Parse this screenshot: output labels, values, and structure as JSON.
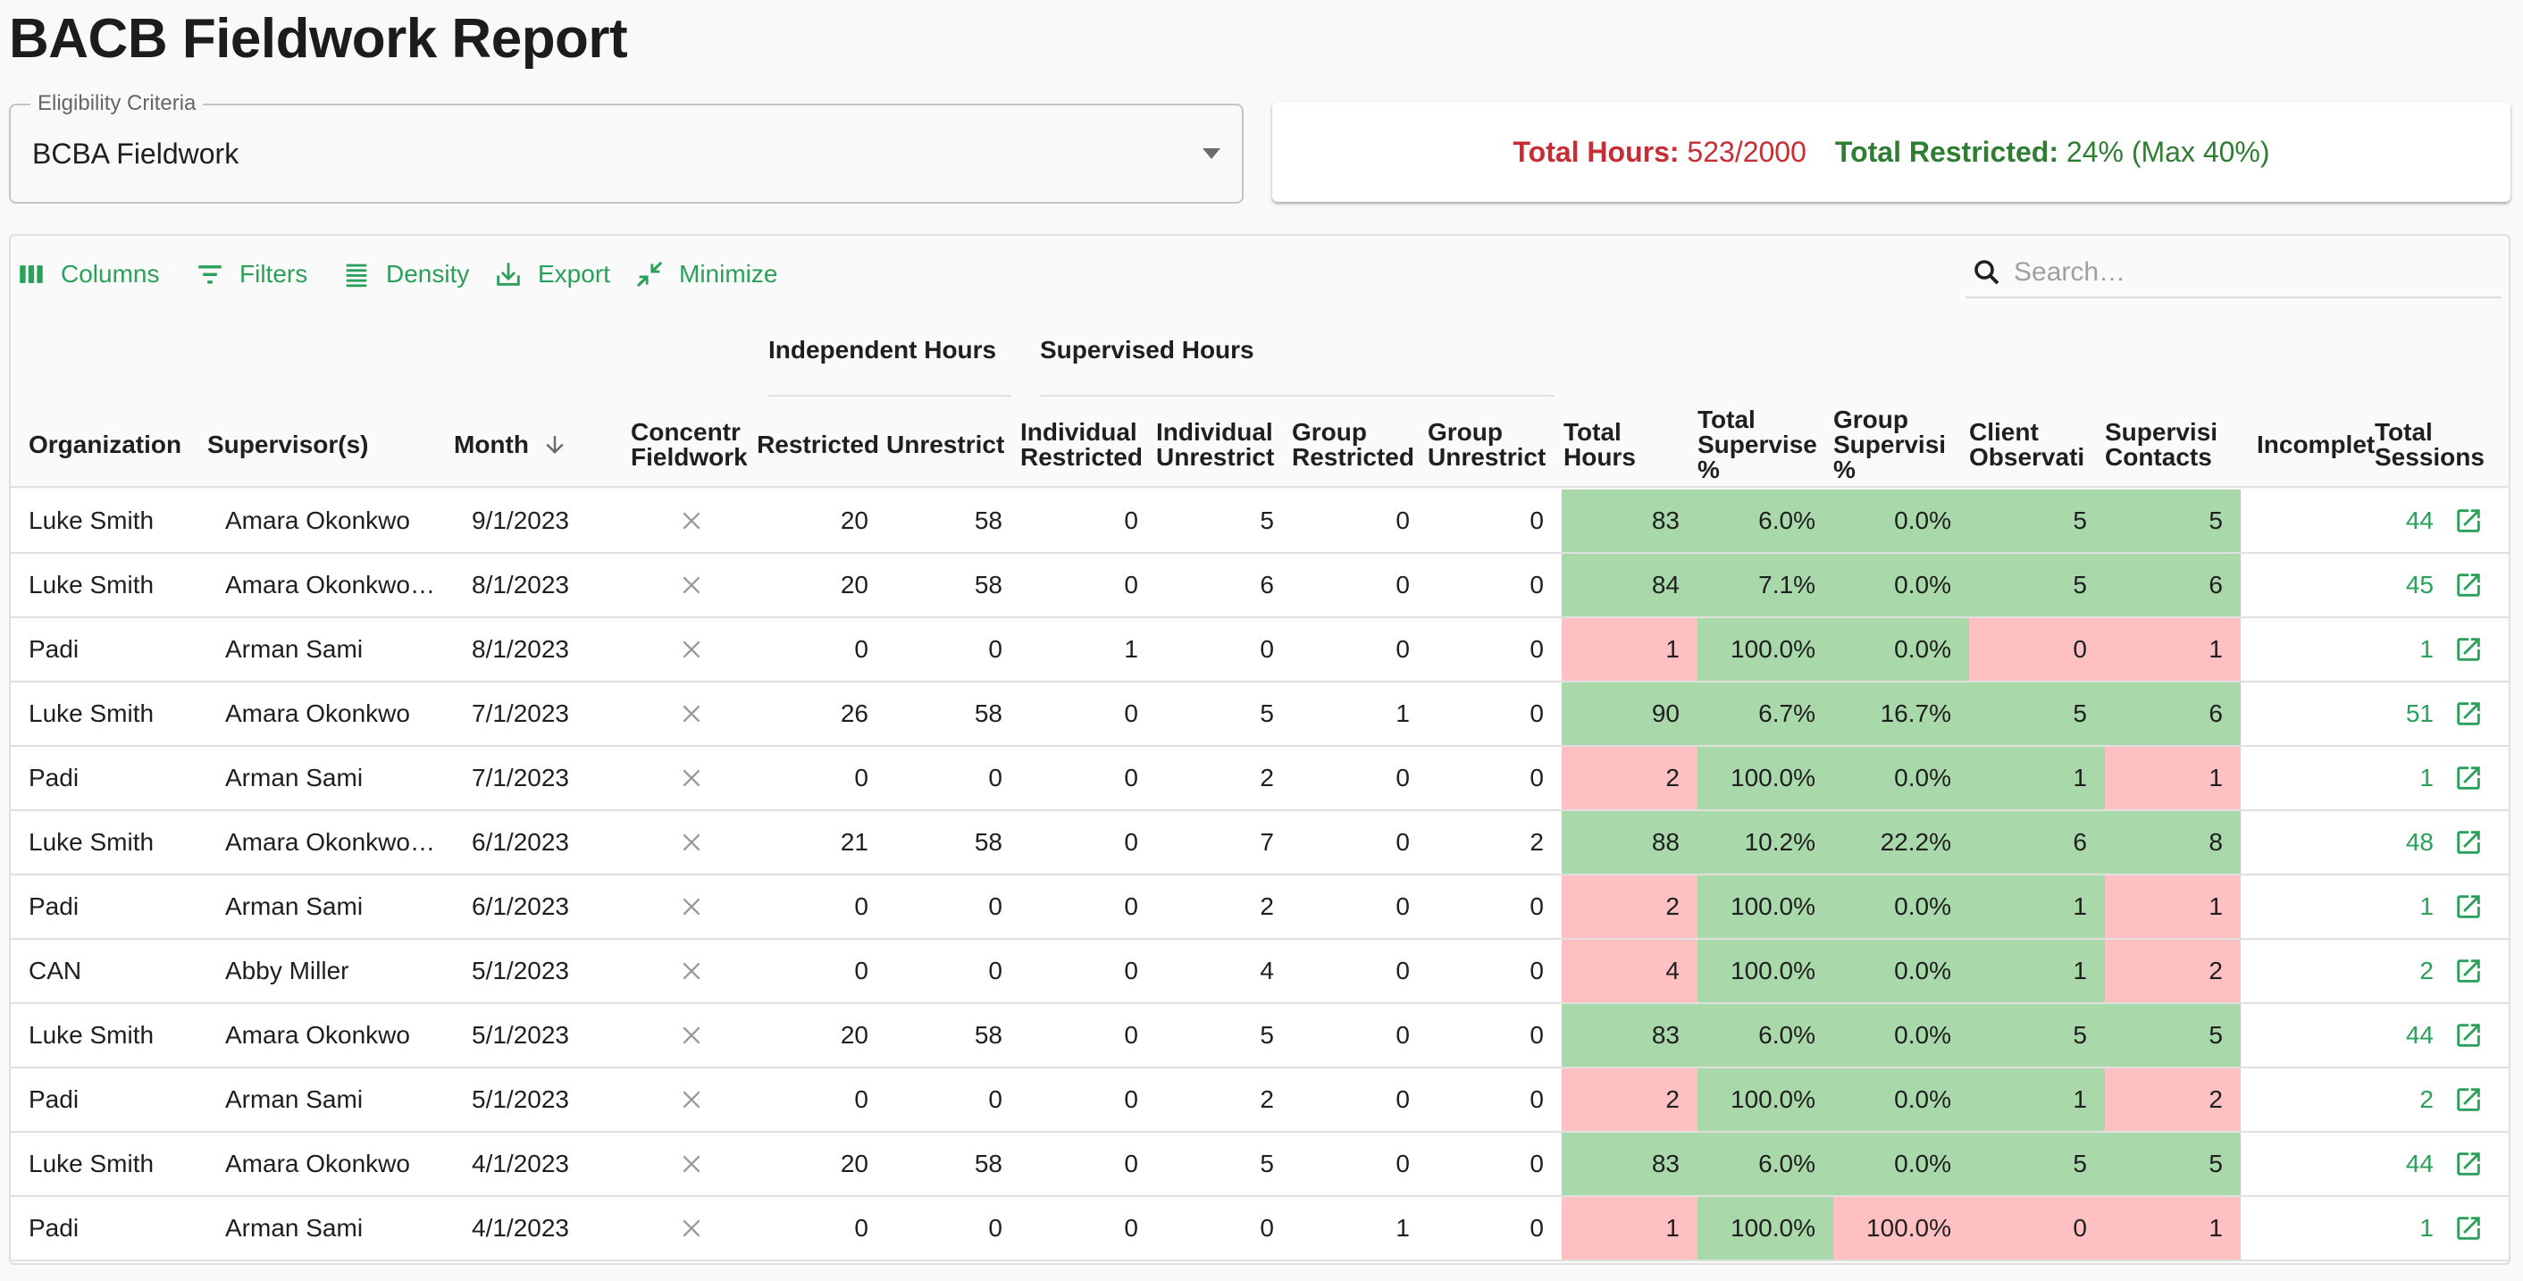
{
  "page": {
    "title": "BACB Fieldwork Report"
  },
  "eligibility": {
    "label": "Eligibility Criteria",
    "value": "BCBA Fieldwork",
    "icon": "arrow-drop-down-icon"
  },
  "summary": {
    "total_hours_label": "Total Hours:",
    "total_hours_value": "523/2000",
    "total_restricted_label": "Total Restricted:",
    "total_restricted_value": "24% (Max 40%)",
    "colors": {
      "hours": "#c62d34",
      "restricted": "#2e7d32"
    }
  },
  "toolbar": {
    "columns": {
      "label": "Columns",
      "icon": "view-column-icon"
    },
    "filters": {
      "label": "Filters",
      "icon": "filter-list-icon"
    },
    "density": {
      "label": "Density",
      "icon": "density-icon"
    },
    "export": {
      "label": "Export",
      "icon": "download-icon"
    },
    "minimize": {
      "label": "Minimize",
      "icon": "minimize-icon"
    },
    "search_placeholder": "Search…",
    "accent": "#2aa05a"
  },
  "table": {
    "group_headers": {
      "independent": "Independent Hours",
      "supervised": "Supervised Hours"
    },
    "columns": {
      "organization": "Organization",
      "supervisors": "Supervisor(s)",
      "month": "Month",
      "concentrated": "Concentr Fieldwork",
      "restricted": "Restricted",
      "unrestricted": "Unrestrict",
      "ind_restricted": "Individual Restricted",
      "ind_unrestricted": "Individual Unrestrict",
      "grp_restricted": "Group Restricted",
      "grp_unrestricted": "Group Unrestrict",
      "total_hours": "Total Hours",
      "total_supervised_pct": "Total Supervise %",
      "group_supervision_pct": "Group Supervisi %",
      "client_observations": "Client Observati",
      "supervision_contacts": "Supervisi Contacts",
      "incomplete": "Incomplet",
      "total_sessions": "Total Sessions"
    },
    "sort": {
      "column": "month",
      "direction": "descending"
    },
    "status_colors": {
      "ok": "#a9d9aa",
      "bad": "#ffc0c2"
    },
    "rows": [
      {
        "organization": "Luke Smith",
        "supervisors": "Amara Okonkwo",
        "month": "9/1/2023",
        "concentrated": false,
        "restricted": "20",
        "unrestricted": "58",
        "ind_restricted": "0",
        "ind_unrestricted": "5",
        "grp_restricted": "0",
        "grp_unrestricted": "0",
        "total_hours": "83",
        "total_supervised_pct": "6.0%",
        "group_supervision_pct": "0.0%",
        "client_observations": "5",
        "supervision_contacts": "5",
        "incomplete": "",
        "total_sessions": "44",
        "status": {
          "total_hours": "ok",
          "total_supervised_pct": "ok",
          "group_supervision_pct": "ok",
          "client_observations": "ok",
          "supervision_contacts": "ok"
        }
      },
      {
        "organization": "Luke Smith",
        "supervisors": "Amara Okonkwo…",
        "month": "8/1/2023",
        "concentrated": false,
        "restricted": "20",
        "unrestricted": "58",
        "ind_restricted": "0",
        "ind_unrestricted": "6",
        "grp_restricted": "0",
        "grp_unrestricted": "0",
        "total_hours": "84",
        "total_supervised_pct": "7.1%",
        "group_supervision_pct": "0.0%",
        "client_observations": "5",
        "supervision_contacts": "6",
        "incomplete": "",
        "total_sessions": "45",
        "status": {
          "total_hours": "ok",
          "total_supervised_pct": "ok",
          "group_supervision_pct": "ok",
          "client_observations": "ok",
          "supervision_contacts": "ok"
        }
      },
      {
        "organization": "Padi",
        "supervisors": "Arman Sami",
        "month": "8/1/2023",
        "concentrated": false,
        "restricted": "0",
        "unrestricted": "0",
        "ind_restricted": "1",
        "ind_unrestricted": "0",
        "grp_restricted": "0",
        "grp_unrestricted": "0",
        "total_hours": "1",
        "total_supervised_pct": "100.0%",
        "group_supervision_pct": "0.0%",
        "client_observations": "0",
        "supervision_contacts": "1",
        "incomplete": "",
        "total_sessions": "1",
        "status": {
          "total_hours": "bad",
          "total_supervised_pct": "ok",
          "group_supervision_pct": "ok",
          "client_observations": "bad",
          "supervision_contacts": "bad"
        }
      },
      {
        "organization": "Luke Smith",
        "supervisors": "Amara Okonkwo",
        "month": "7/1/2023",
        "concentrated": false,
        "restricted": "26",
        "unrestricted": "58",
        "ind_restricted": "0",
        "ind_unrestricted": "5",
        "grp_restricted": "1",
        "grp_unrestricted": "0",
        "total_hours": "90",
        "total_supervised_pct": "6.7%",
        "group_supervision_pct": "16.7%",
        "client_observations": "5",
        "supervision_contacts": "6",
        "incomplete": "",
        "total_sessions": "51",
        "status": {
          "total_hours": "ok",
          "total_supervised_pct": "ok",
          "group_supervision_pct": "ok",
          "client_observations": "ok",
          "supervision_contacts": "ok"
        }
      },
      {
        "organization": "Padi",
        "supervisors": "Arman Sami",
        "month": "7/1/2023",
        "concentrated": false,
        "restricted": "0",
        "unrestricted": "0",
        "ind_restricted": "0",
        "ind_unrestricted": "2",
        "grp_restricted": "0",
        "grp_unrestricted": "0",
        "total_hours": "2",
        "total_supervised_pct": "100.0%",
        "group_supervision_pct": "0.0%",
        "client_observations": "1",
        "supervision_contacts": "1",
        "incomplete": "",
        "total_sessions": "1",
        "status": {
          "total_hours": "bad",
          "total_supervised_pct": "ok",
          "group_supervision_pct": "ok",
          "client_observations": "ok",
          "supervision_contacts": "bad"
        }
      },
      {
        "organization": "Luke Smith",
        "supervisors": "Amara Okonkwo…",
        "month": "6/1/2023",
        "concentrated": false,
        "restricted": "21",
        "unrestricted": "58",
        "ind_restricted": "0",
        "ind_unrestricted": "7",
        "grp_restricted": "0",
        "grp_unrestricted": "2",
        "total_hours": "88",
        "total_supervised_pct": "10.2%",
        "group_supervision_pct": "22.2%",
        "client_observations": "6",
        "supervision_contacts": "8",
        "incomplete": "",
        "total_sessions": "48",
        "status": {
          "total_hours": "ok",
          "total_supervised_pct": "ok",
          "group_supervision_pct": "ok",
          "client_observations": "ok",
          "supervision_contacts": "ok"
        }
      },
      {
        "organization": "Padi",
        "supervisors": "Arman Sami",
        "month": "6/1/2023",
        "concentrated": false,
        "restricted": "0",
        "unrestricted": "0",
        "ind_restricted": "0",
        "ind_unrestricted": "2",
        "grp_restricted": "0",
        "grp_unrestricted": "0",
        "total_hours": "2",
        "total_supervised_pct": "100.0%",
        "group_supervision_pct": "0.0%",
        "client_observations": "1",
        "supervision_contacts": "1",
        "incomplete": "",
        "total_sessions": "1",
        "status": {
          "total_hours": "bad",
          "total_supervised_pct": "ok",
          "group_supervision_pct": "ok",
          "client_observations": "ok",
          "supervision_contacts": "bad"
        }
      },
      {
        "organization": "CAN",
        "supervisors": "Abby Miller",
        "month": "5/1/2023",
        "concentrated": false,
        "restricted": "0",
        "unrestricted": "0",
        "ind_restricted": "0",
        "ind_unrestricted": "4",
        "grp_restricted": "0",
        "grp_unrestricted": "0",
        "total_hours": "4",
        "total_supervised_pct": "100.0%",
        "group_supervision_pct": "0.0%",
        "client_observations": "1",
        "supervision_contacts": "2",
        "incomplete": "",
        "total_sessions": "2",
        "status": {
          "total_hours": "bad",
          "total_supervised_pct": "ok",
          "group_supervision_pct": "ok",
          "client_observations": "ok",
          "supervision_contacts": "bad"
        }
      },
      {
        "organization": "Luke Smith",
        "supervisors": "Amara Okonkwo",
        "month": "5/1/2023",
        "concentrated": false,
        "restricted": "20",
        "unrestricted": "58",
        "ind_restricted": "0",
        "ind_unrestricted": "5",
        "grp_restricted": "0",
        "grp_unrestricted": "0",
        "total_hours": "83",
        "total_supervised_pct": "6.0%",
        "group_supervision_pct": "0.0%",
        "client_observations": "5",
        "supervision_contacts": "5",
        "incomplete": "",
        "total_sessions": "44",
        "status": {
          "total_hours": "ok",
          "total_supervised_pct": "ok",
          "group_supervision_pct": "ok",
          "client_observations": "ok",
          "supervision_contacts": "ok"
        }
      },
      {
        "organization": "Padi",
        "supervisors": "Arman Sami",
        "month": "5/1/2023",
        "concentrated": false,
        "restricted": "0",
        "unrestricted": "0",
        "ind_restricted": "0",
        "ind_unrestricted": "2",
        "grp_restricted": "0",
        "grp_unrestricted": "0",
        "total_hours": "2",
        "total_supervised_pct": "100.0%",
        "group_supervision_pct": "0.0%",
        "client_observations": "1",
        "supervision_contacts": "2",
        "incomplete": "",
        "total_sessions": "2",
        "status": {
          "total_hours": "bad",
          "total_supervised_pct": "ok",
          "group_supervision_pct": "ok",
          "client_observations": "ok",
          "supervision_contacts": "bad"
        }
      },
      {
        "organization": "Luke Smith",
        "supervisors": "Amara Okonkwo",
        "month": "4/1/2023",
        "concentrated": false,
        "restricted": "20",
        "unrestricted": "58",
        "ind_restricted": "0",
        "ind_unrestricted": "5",
        "grp_restricted": "0",
        "grp_unrestricted": "0",
        "total_hours": "83",
        "total_supervised_pct": "6.0%",
        "group_supervision_pct": "0.0%",
        "client_observations": "5",
        "supervision_contacts": "5",
        "incomplete": "",
        "total_sessions": "44",
        "status": {
          "total_hours": "ok",
          "total_supervised_pct": "ok",
          "group_supervision_pct": "ok",
          "client_observations": "ok",
          "supervision_contacts": "ok"
        }
      },
      {
        "organization": "Padi",
        "supervisors": "Arman Sami",
        "month": "4/1/2023",
        "concentrated": false,
        "restricted": "0",
        "unrestricted": "0",
        "ind_restricted": "0",
        "ind_unrestricted": "0",
        "grp_restricted": "1",
        "grp_unrestricted": "0",
        "total_hours": "1",
        "total_supervised_pct": "100.0%",
        "group_supervision_pct": "100.0%",
        "client_observations": "0",
        "supervision_contacts": "1",
        "incomplete": "",
        "total_sessions": "1",
        "status": {
          "total_hours": "bad",
          "total_supervised_pct": "ok",
          "group_supervision_pct": "bad",
          "client_observations": "bad",
          "supervision_contacts": "bad"
        }
      }
    ]
  }
}
